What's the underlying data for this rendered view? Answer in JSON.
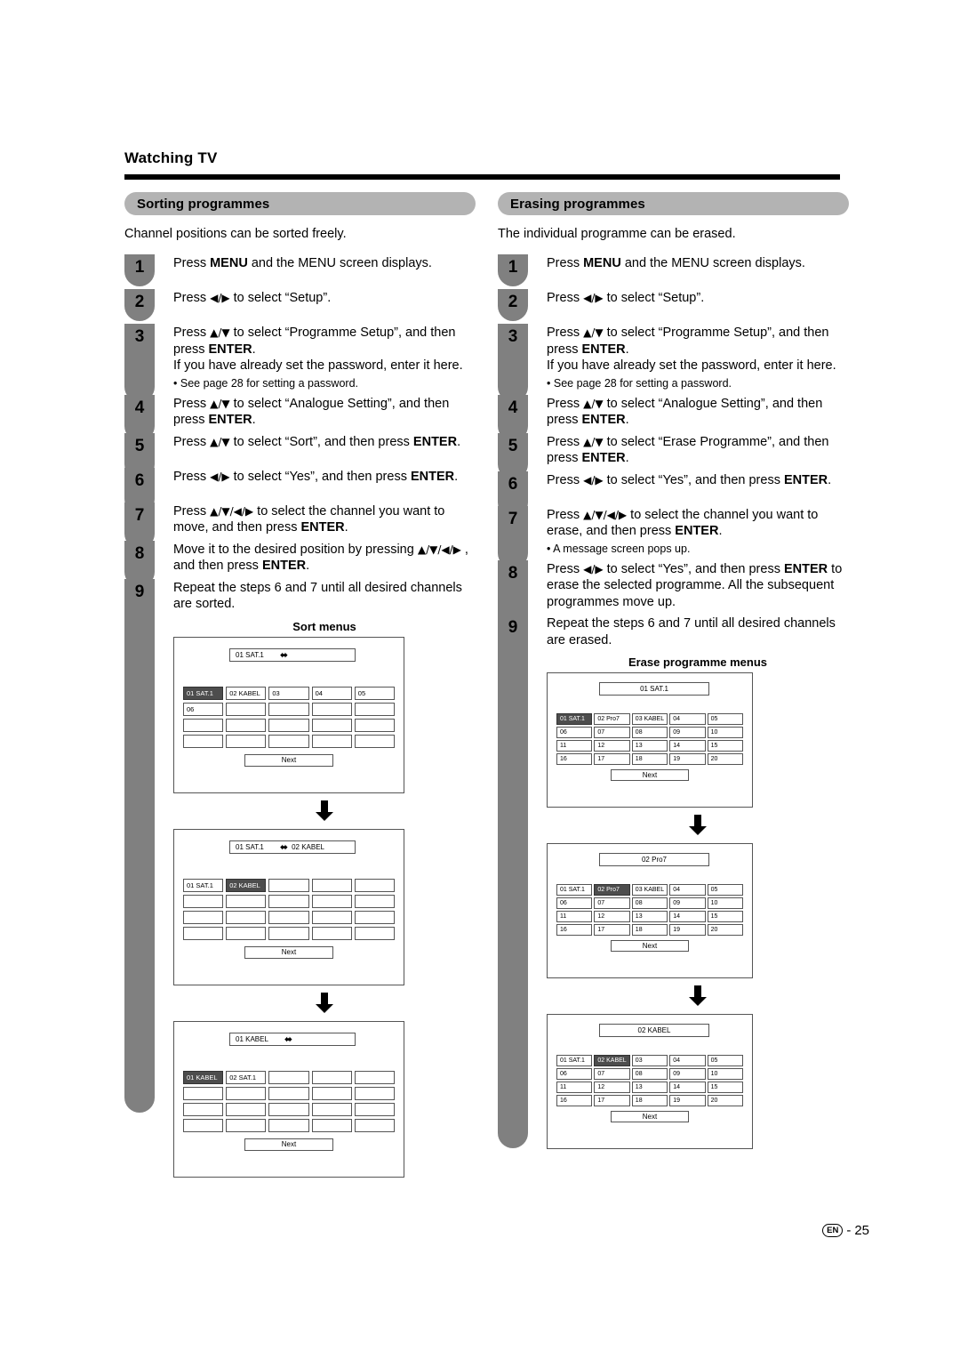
{
  "page": {
    "chapter_title": "Watching TV",
    "footer_locale": "EN",
    "footer_separator": "-",
    "footer_page": "25"
  },
  "left": {
    "section_title": "Sorting programmes",
    "intro": "Channel positions can be sorted freely.",
    "steps": [
      {
        "num": "1",
        "html": "Press <b>MENU</b> and the MENU screen displays."
      },
      {
        "num": "2",
        "html": "Press <span class=\"arr\">◀/▶</span> to select “Setup”."
      },
      {
        "num": "3",
        "html": "Press <span class=\"arr\">▲/▼</span> to select “Programme Setup”, and then press <b>ENTER</b>.<br>If you have already set the password, enter it here.",
        "sub": "See page 28 for setting a password."
      },
      {
        "num": "4",
        "html": "Press <span class=\"arr\">▲/▼</span> to select “Analogue Setting”, and then press <b>ENTER</b>."
      },
      {
        "num": "5",
        "html": "Press <span class=\"arr\">▲/▼</span> to select “Sort”, and then press <b>ENTER</b>."
      },
      {
        "num": "6",
        "html": "Press <span class=\"arr\">◀/▶</span> to select “Yes”, and then press <b>ENTER</b>."
      },
      {
        "num": "7",
        "html": "Press <span class=\"arr\">▲/▼/◀/▶</span> to select the channel you want to move, and then press <b>ENTER</b>."
      },
      {
        "num": "8",
        "html": "Move it to the desired position by pressing <span class=\"arr\">▲/▼/◀/▶</span> , and then press <b>ENTER</b>."
      },
      {
        "num": "9",
        "html": "Repeat the steps 6 and 7 until all desired channels are sorted."
      }
    ],
    "diagram_caption": "Sort menus",
    "menus": [
      {
        "title": "01  SAT.1",
        "title_suffix": "",
        "cells": [
          {
            "label": "01  SAT.1",
            "selected": true
          },
          {
            "label": "02  KABEL",
            "selected": false
          },
          {
            "label": "03",
            "selected": false
          },
          {
            "label": "04",
            "selected": false
          },
          {
            "label": "05",
            "selected": false
          },
          {
            "label": "06",
            "selected": false
          },
          {
            "label": "",
            "selected": false
          },
          {
            "label": "",
            "selected": false
          },
          {
            "label": "",
            "selected": false
          },
          {
            "label": "",
            "selected": false
          },
          {
            "label": "",
            "selected": false
          },
          {
            "label": "",
            "selected": false
          },
          {
            "label": "",
            "selected": false
          },
          {
            "label": "",
            "selected": false
          },
          {
            "label": "",
            "selected": false
          },
          {
            "label": "",
            "selected": false
          },
          {
            "label": "",
            "selected": false
          },
          {
            "label": "",
            "selected": false
          },
          {
            "label": "",
            "selected": false
          },
          {
            "label": "",
            "selected": false
          }
        ],
        "next_label": "Next"
      },
      {
        "title": "01  SAT.1",
        "title_suffix": "02  KABEL",
        "cells": [
          {
            "label": "01  SAT.1",
            "selected": false
          },
          {
            "label": "02  KABEL",
            "selected": true
          },
          {
            "label": "",
            "selected": false
          },
          {
            "label": "",
            "selected": false
          },
          {
            "label": "",
            "selected": false
          },
          {
            "label": "",
            "selected": false
          },
          {
            "label": "",
            "selected": false
          },
          {
            "label": "",
            "selected": false
          },
          {
            "label": "",
            "selected": false
          },
          {
            "label": "",
            "selected": false
          },
          {
            "label": "",
            "selected": false
          },
          {
            "label": "",
            "selected": false
          },
          {
            "label": "",
            "selected": false
          },
          {
            "label": "",
            "selected": false
          },
          {
            "label": "",
            "selected": false
          },
          {
            "label": "",
            "selected": false
          },
          {
            "label": "",
            "selected": false
          },
          {
            "label": "",
            "selected": false
          },
          {
            "label": "",
            "selected": false
          },
          {
            "label": "",
            "selected": false
          }
        ],
        "next_label": "Next"
      },
      {
        "title": "01  KABEL",
        "title_suffix": "",
        "cells": [
          {
            "label": "01  KABEL",
            "selected": true
          },
          {
            "label": "02  SAT.1",
            "selected": false
          },
          {
            "label": "",
            "selected": false
          },
          {
            "label": "",
            "selected": false
          },
          {
            "label": "",
            "selected": false
          },
          {
            "label": "",
            "selected": false
          },
          {
            "label": "",
            "selected": false
          },
          {
            "label": "",
            "selected": false
          },
          {
            "label": "",
            "selected": false
          },
          {
            "label": "",
            "selected": false
          },
          {
            "label": "",
            "selected": false
          },
          {
            "label": "",
            "selected": false
          },
          {
            "label": "",
            "selected": false
          },
          {
            "label": "",
            "selected": false
          },
          {
            "label": "",
            "selected": false
          },
          {
            "label": "",
            "selected": false
          },
          {
            "label": "",
            "selected": false
          },
          {
            "label": "",
            "selected": false
          },
          {
            "label": "",
            "selected": false
          },
          {
            "label": "",
            "selected": false
          }
        ],
        "next_label": "Next"
      }
    ]
  },
  "right": {
    "section_title": "Erasing programmes",
    "intro": "The individual programme can be erased.",
    "steps": [
      {
        "num": "1",
        "html": "Press <b>MENU</b> and the MENU screen displays."
      },
      {
        "num": "2",
        "html": "Press <span class=\"arr\">◀/▶</span> to select “Setup”."
      },
      {
        "num": "3",
        "html": "Press <span class=\"arr\">▲/▼</span> to select “Programme Setup”, and then press <b>ENTER</b>.<br>If you have already set the password, enter it here.",
        "sub": "See page 28 for setting a password."
      },
      {
        "num": "4",
        "html": "Press <span class=\"arr\">▲/▼</span> to select “Analogue Setting”, and then press <b>ENTER</b>."
      },
      {
        "num": "5",
        "html": "Press <span class=\"arr\">▲/▼</span> to select “Erase Programme”, and then press <b>ENTER</b>."
      },
      {
        "num": "6",
        "html": "Press <span class=\"arr\">◀/▶</span> to select “Yes”, and then press <b>ENTER</b>."
      },
      {
        "num": "7",
        "html": "Press <span class=\"arr\">▲/▼/◀/▶</span> to select the channel you want to erase, and then press <b>ENTER</b>.",
        "sub": "A message screen pops up."
      },
      {
        "num": "8",
        "html": "Press <span class=\"arr\">◀/▶</span> to select “Yes”, and then press <b>ENTER</b> to erase the selected programme. All the subsequent programmes move up."
      },
      {
        "num": "9",
        "html": "Repeat the steps 6 and 7 until all desired channels are erased."
      }
    ],
    "diagram_caption": "Erase programme menus",
    "menus": [
      {
        "title": "01  SAT.1",
        "cells": [
          {
            "label": "01  SAT.1",
            "selected": true
          },
          {
            "label": "02  Pro7",
            "selected": false
          },
          {
            "label": "03  KABEL",
            "selected": false
          },
          {
            "label": "04",
            "selected": false
          },
          {
            "label": "05",
            "selected": false
          },
          {
            "label": "06",
            "selected": false
          },
          {
            "label": "07",
            "selected": false
          },
          {
            "label": "08",
            "selected": false
          },
          {
            "label": "09",
            "selected": false
          },
          {
            "label": "10",
            "selected": false
          },
          {
            "label": "11",
            "selected": false
          },
          {
            "label": "12",
            "selected": false
          },
          {
            "label": "13",
            "selected": false
          },
          {
            "label": "14",
            "selected": false
          },
          {
            "label": "15",
            "selected": false
          },
          {
            "label": "16",
            "selected": false
          },
          {
            "label": "17",
            "selected": false
          },
          {
            "label": "18",
            "selected": false
          },
          {
            "label": "19",
            "selected": false
          },
          {
            "label": "20",
            "selected": false
          }
        ],
        "next_label": "Next"
      },
      {
        "title": "02  Pro7",
        "cells": [
          {
            "label": "01  SAT.1",
            "selected": false
          },
          {
            "label": "02  Pro7",
            "selected": true
          },
          {
            "label": "03  KABEL",
            "selected": false
          },
          {
            "label": "04",
            "selected": false
          },
          {
            "label": "05",
            "selected": false
          },
          {
            "label": "06",
            "selected": false
          },
          {
            "label": "07",
            "selected": false
          },
          {
            "label": "08",
            "selected": false
          },
          {
            "label": "09",
            "selected": false
          },
          {
            "label": "10",
            "selected": false
          },
          {
            "label": "11",
            "selected": false
          },
          {
            "label": "12",
            "selected": false
          },
          {
            "label": "13",
            "selected": false
          },
          {
            "label": "14",
            "selected": false
          },
          {
            "label": "15",
            "selected": false
          },
          {
            "label": "16",
            "selected": false
          },
          {
            "label": "17",
            "selected": false
          },
          {
            "label": "18",
            "selected": false
          },
          {
            "label": "19",
            "selected": false
          },
          {
            "label": "20",
            "selected": false
          }
        ],
        "next_label": "Next"
      },
      {
        "title": "02  KABEL",
        "cells": [
          {
            "label": "01  SAT.1",
            "selected": false
          },
          {
            "label": "02  KABEL",
            "selected": true
          },
          {
            "label": "03",
            "selected": false
          },
          {
            "label": "04",
            "selected": false
          },
          {
            "label": "05",
            "selected": false
          },
          {
            "label": "06",
            "selected": false
          },
          {
            "label": "07",
            "selected": false
          },
          {
            "label": "08",
            "selected": false
          },
          {
            "label": "09",
            "selected": false
          },
          {
            "label": "10",
            "selected": false
          },
          {
            "label": "11",
            "selected": false
          },
          {
            "label": "12",
            "selected": false
          },
          {
            "label": "13",
            "selected": false
          },
          {
            "label": "14",
            "selected": false
          },
          {
            "label": "15",
            "selected": false
          },
          {
            "label": "16",
            "selected": false
          },
          {
            "label": "17",
            "selected": false
          },
          {
            "label": "18",
            "selected": false
          },
          {
            "label": "19",
            "selected": false
          },
          {
            "label": "20",
            "selected": false
          }
        ],
        "next_label": "Next"
      }
    ]
  },
  "colors": {
    "pill_bg": "#b3b3b3",
    "badge_bg": "#808080",
    "selected_cell_bg": "#4d4d4d",
    "rule": "#000000"
  }
}
